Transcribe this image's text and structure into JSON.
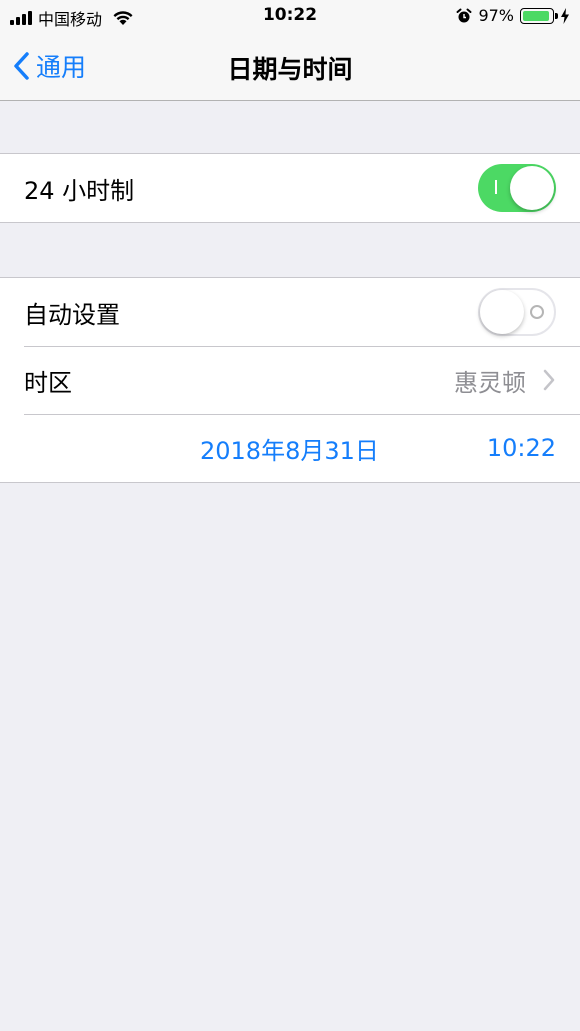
{
  "status_bar": {
    "carrier": "中国移动",
    "time": "10:22",
    "battery_percent": "97%",
    "battery_level": 0.97,
    "battery_color": "#4cd964",
    "icons": [
      "signal-icon",
      "wifi-icon",
      "alarm-icon",
      "battery-icon",
      "charging-bolt-icon"
    ]
  },
  "nav": {
    "back_label": "通用",
    "title": "日期与时间",
    "accent_color": "#157efb"
  },
  "settings": {
    "hour24": {
      "label": "24 小时制",
      "enabled": true
    },
    "auto_set": {
      "label": "自动设置",
      "enabled": false
    },
    "timezone": {
      "label": "时区",
      "value": "惠灵顿"
    },
    "datetime": {
      "date": "2018年8月31日",
      "time": "10:22"
    }
  }
}
